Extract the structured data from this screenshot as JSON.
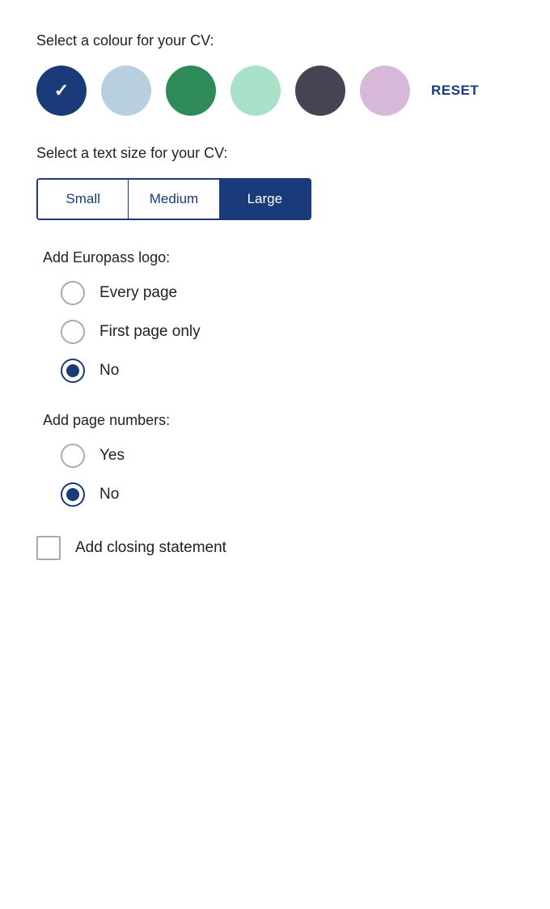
{
  "colour_section": {
    "label": "Select a colour for your CV:",
    "swatches": [
      {
        "id": "dark-blue",
        "color": "#1a3a7a",
        "selected": true
      },
      {
        "id": "light-blue-gray",
        "color": "#b8cfe0",
        "selected": false
      },
      {
        "id": "green",
        "color": "#2e8b57",
        "selected": false
      },
      {
        "id": "mint",
        "color": "#a8e0c8",
        "selected": false
      },
      {
        "id": "dark-gray",
        "color": "#444455",
        "selected": false
      },
      {
        "id": "lavender",
        "color": "#d8b8d8",
        "selected": false
      }
    ],
    "reset_label": "RESET"
  },
  "text_size_section": {
    "label": "Select a text size for your CV:",
    "sizes": [
      {
        "id": "small",
        "label": "Small",
        "active": false
      },
      {
        "id": "medium",
        "label": "Medium",
        "active": false
      },
      {
        "id": "large",
        "label": "Large",
        "active": true
      }
    ]
  },
  "logo_section": {
    "label": "Add Europass logo:",
    "options": [
      {
        "id": "every-page",
        "label": "Every page",
        "checked": false
      },
      {
        "id": "first-page-only",
        "label": "First page only",
        "checked": false
      },
      {
        "id": "no-logo",
        "label": "No",
        "checked": true
      }
    ]
  },
  "page_numbers_section": {
    "label": "Add page numbers:",
    "options": [
      {
        "id": "yes-numbers",
        "label": "Yes",
        "checked": false
      },
      {
        "id": "no-numbers",
        "label": "No",
        "checked": true
      }
    ]
  },
  "closing_statement": {
    "label": "Add closing statement",
    "checked": false
  }
}
